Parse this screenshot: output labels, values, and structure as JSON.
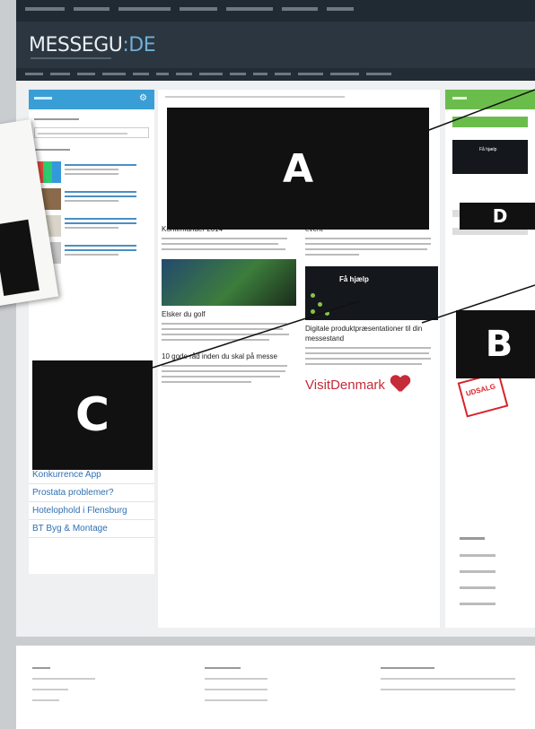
{
  "site": {
    "logo_main": "MESSEGU",
    "logo_accent": ":DE"
  },
  "left_sidebar": {
    "menu_items": [
      "Konkurrence App",
      "Prostata problemer?",
      "Hotelophold i Flensburg",
      "BT Byg & Montage"
    ]
  },
  "content": {
    "col_left": {
      "article1_title": "Konfirmander 2014",
      "article2_title": "Elsker du golf",
      "article3_title": "10 gode råd inden du skal på messe"
    },
    "col_right": {
      "article1_title": "event",
      "help_banner": "Få hjælp",
      "article2_title": "Digitale produktpræsentationer til din messestand",
      "visitdenmark": "VisitDenmark"
    }
  },
  "right_sidebar": {
    "help_banner": "Få hjælp",
    "udsalg": "UDSALG"
  },
  "callouts": {
    "a": "A",
    "b": "B",
    "c": "C",
    "d": "D"
  },
  "colors": {
    "left_sidebar_header": "#3a9ed6",
    "right_sidebar_header": "#6bbd4b",
    "nav_bg": "#2b3640",
    "link": "#2f6fb2",
    "visitdenmark": "#c62b3a"
  }
}
